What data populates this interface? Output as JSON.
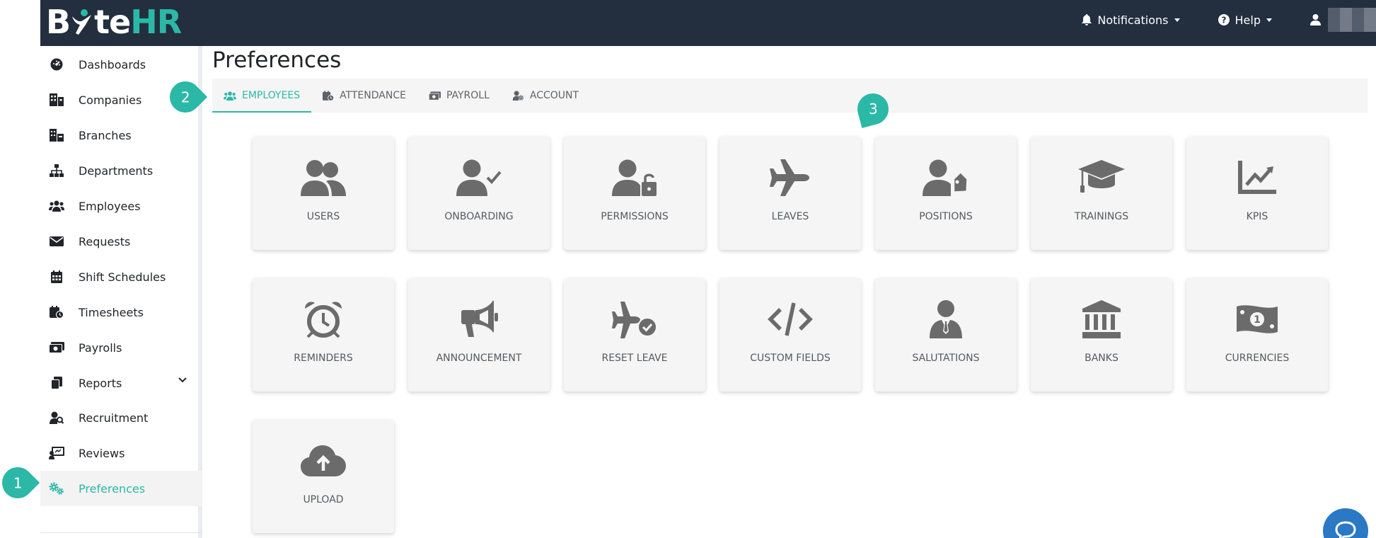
{
  "brand": {
    "logo_b": "B",
    "logo_mid": "te",
    "logo_hr": "HR",
    "accent_color": "#2bb8a6",
    "navbar_color": "#232e3f"
  },
  "navbar": {
    "notifications_label": "Notifications",
    "help_label": "Help"
  },
  "sidebar": {
    "items": [
      {
        "label": "Dashboards",
        "icon": "dashboard-icon"
      },
      {
        "label": "Companies",
        "icon": "building-icon"
      },
      {
        "label": "Branches",
        "icon": "branches-icon"
      },
      {
        "label": "Departments",
        "icon": "sitemap-icon"
      },
      {
        "label": "Employees",
        "icon": "users-icon"
      },
      {
        "label": "Requests",
        "icon": "envelope-icon"
      },
      {
        "label": "Shift Schedules",
        "icon": "calendar-icon"
      },
      {
        "label": "Timesheets",
        "icon": "calendar-clock-icon"
      },
      {
        "label": "Payrolls",
        "icon": "money-icon"
      },
      {
        "label": "Reports",
        "icon": "copy-icon"
      },
      {
        "label": "Recruitment",
        "icon": "user-search-icon"
      },
      {
        "label": "Reviews",
        "icon": "chalkboard-icon"
      },
      {
        "label": "Preferences",
        "icon": "cogs-icon"
      }
    ]
  },
  "page": {
    "title": "Preferences"
  },
  "tabs": [
    {
      "label": "Employees",
      "icon": "users-icon"
    },
    {
      "label": "Attendance",
      "icon": "calendar-clock-icon"
    },
    {
      "label": "Payroll",
      "icon": "money-icon"
    },
    {
      "label": "Account",
      "icon": "user-cog-icon"
    }
  ],
  "cards": [
    {
      "label": "Users",
      "icon": "users-icon"
    },
    {
      "label": "Onboarding",
      "icon": "user-check-icon"
    },
    {
      "label": "Permissions",
      "icon": "user-lock-icon"
    },
    {
      "label": "Leaves",
      "icon": "plane-icon"
    },
    {
      "label": "Positions",
      "icon": "user-tag-icon"
    },
    {
      "label": "Trainings",
      "icon": "graduation-cap-icon"
    },
    {
      "label": "KPIs",
      "icon": "chart-line-icon"
    },
    {
      "label": "Reminders",
      "icon": "alarm-clock-icon"
    },
    {
      "label": "Announcement",
      "icon": "bullhorn-icon"
    },
    {
      "label": "Reset Leave",
      "icon": "plane-check-icon"
    },
    {
      "label": "Custom Fields",
      "icon": "code-icon"
    },
    {
      "label": "Salutations",
      "icon": "user-tie-icon"
    },
    {
      "label": "Banks",
      "icon": "bank-icon"
    },
    {
      "label": "Currencies",
      "icon": "money-bill-icon"
    },
    {
      "label": "Upload",
      "icon": "cloud-upload-icon"
    }
  ],
  "markers": {
    "one": "1",
    "two": "2",
    "three": "3"
  }
}
